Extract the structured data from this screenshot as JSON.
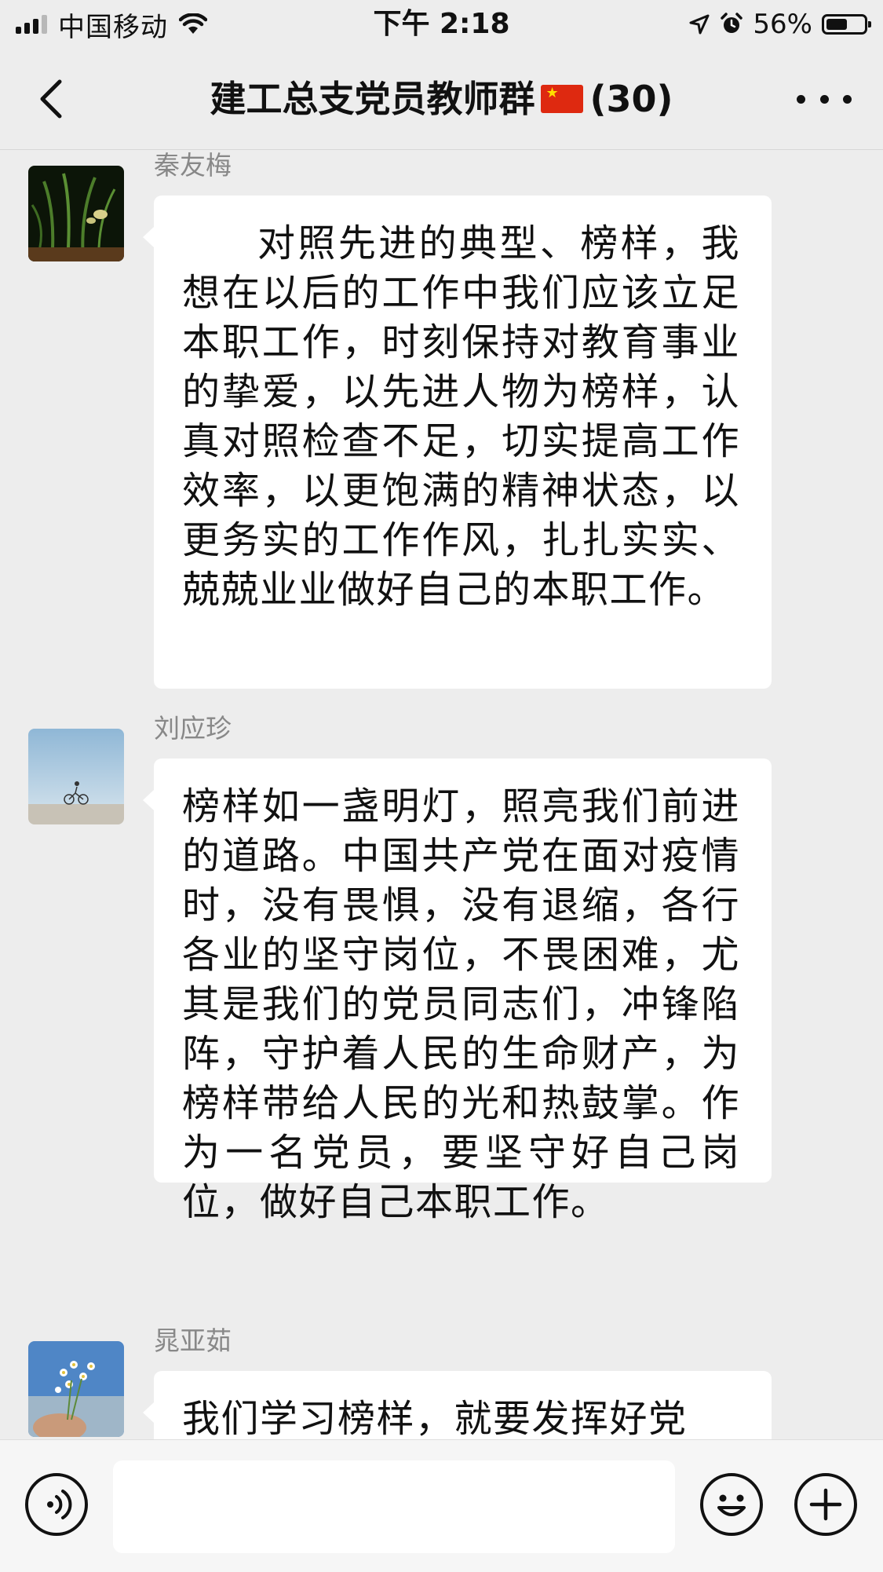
{
  "status_bar": {
    "carrier": "中国移动",
    "time": "下午 2:18",
    "battery": "56%",
    "battery_level": 0.56,
    "signal_bars": 3,
    "icons": [
      "signal-icon",
      "wifi-icon",
      "location-arrow-icon",
      "alarm-icon",
      "battery-icon"
    ]
  },
  "header": {
    "title": "建工总支党员教师群",
    "flag_icon": "china-flag-emoji",
    "member_count": "(30)",
    "back_icon": "chevron-left-icon",
    "more_icon": "more-dots-icon"
  },
  "messages": [
    {
      "sender": "秦友梅",
      "avatar": "orchid-plant-avatar",
      "text": "对照先进的典型、榜样，我想在以后的工作中我们应该立足本职工作，时刻保持对教育事业的挚爱，以先进人物为榜样，认真对照检查不足，切实提高工作效率，以更饱满的精神状态，以更务实的工作作风，扎扎实实、兢兢业业做好自己的本职工作。"
    },
    {
      "sender": "刘应珍",
      "avatar": "cyclist-beach-avatar",
      "text": "榜样如一盏明灯，照亮我们前进的道路。中国共产党在面对疫情时，没有畏惧，没有退缩，各行各业的坚守岗位，不畏困难，尤其是我们的党员同志们，冲锋陷阵，守护着人民的生命财产，为榜样带给人民的光和热鼓掌。作为一名党员，要坚守好自己岗位，做好自己本职工作。"
    },
    {
      "sender": "晁亚茹",
      "avatar": "flowers-sky-avatar",
      "text": "我们学习榜样，就要发挥好党"
    }
  ],
  "input_bar": {
    "voice_icon": "voice-icon",
    "emoji_icon": "smiley-icon",
    "plus_icon": "plus-icon",
    "text_value": ""
  }
}
